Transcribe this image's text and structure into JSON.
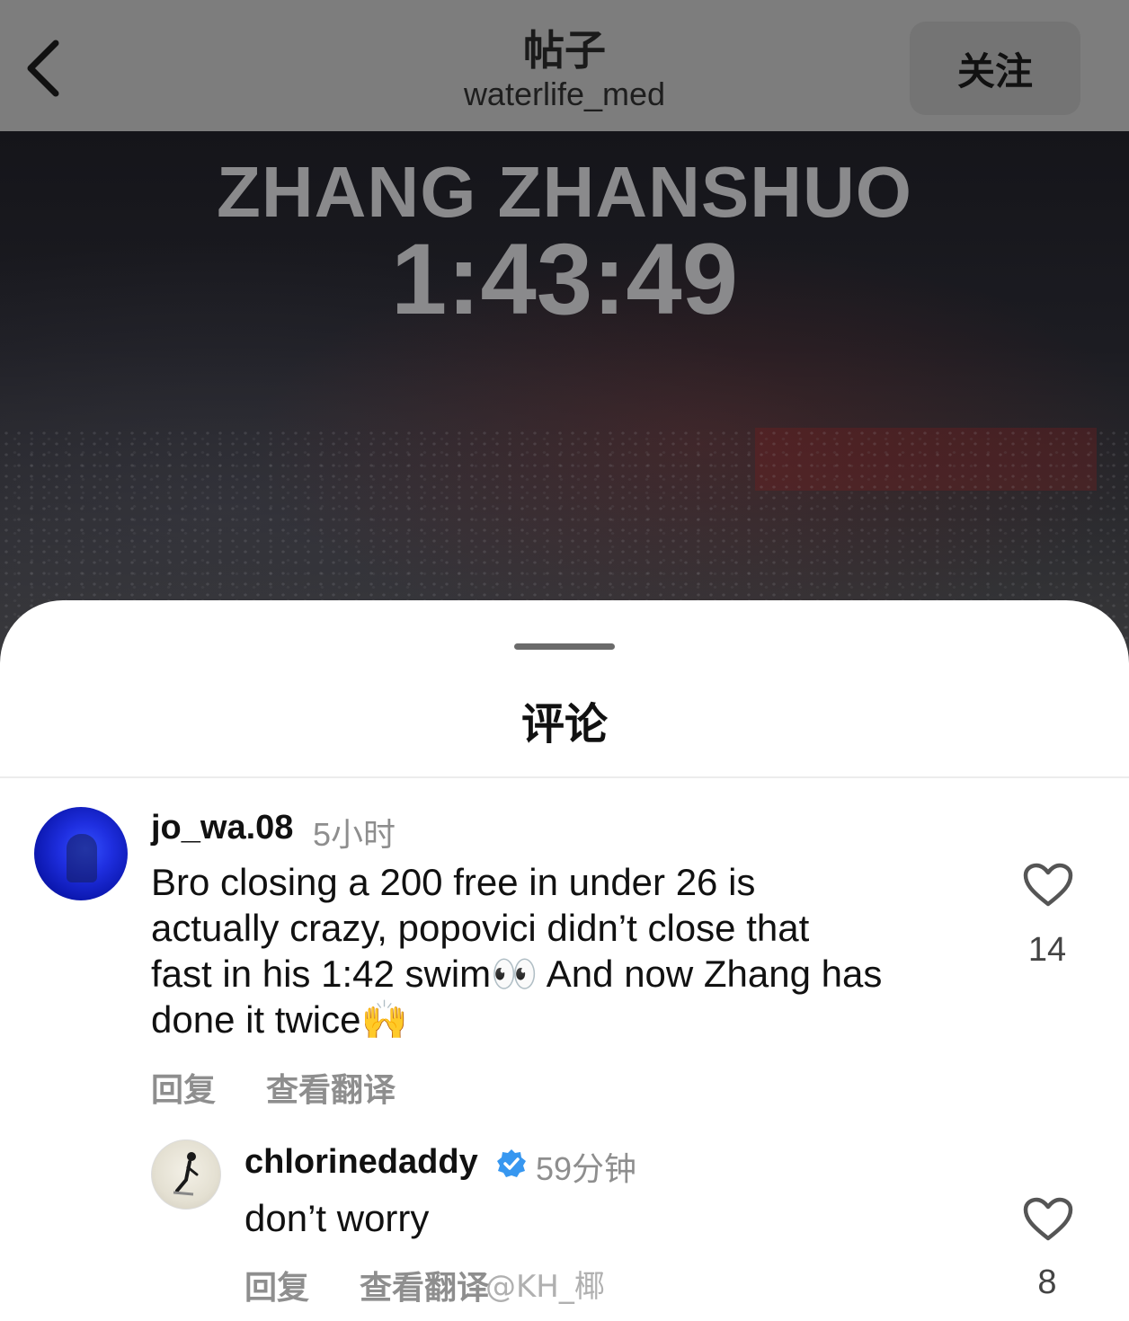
{
  "header": {
    "title": "帖子",
    "username": "waterlife_med",
    "follow_label": "关注"
  },
  "post_image": {
    "athlete_name": "ZHANG ZHANSHUO",
    "time": "1:43:49"
  },
  "comments_sheet": {
    "title": "评论",
    "comments": [
      {
        "username": "jo_wa.08",
        "time": "5小时",
        "text_lines": [
          "Bro closing a 200 free in under 26 is",
          "actually crazy, popovici didn’t close that",
          "fast in his 1:42 swim👀 And now Zhang has",
          "done it twice🙌"
        ],
        "reply_label": "回复",
        "translate_label": "查看翻译",
        "likes": "14"
      },
      {
        "username": "chlorinedaddy",
        "verified": true,
        "time": "59分钟",
        "text": "don’t worry",
        "reply_label": "回复",
        "translate_label": "查看翻译",
        "likes": "8"
      }
    ]
  },
  "watermark": "@KH_椰",
  "icons": {
    "back": "chevron-left-icon",
    "like": "heart-outline-icon",
    "verified": "verified-badge-icon"
  },
  "colors": {
    "header_bg": "#7d7d7d",
    "verified_blue": "#3797f0",
    "secondary_text": "#8e8e8e"
  }
}
